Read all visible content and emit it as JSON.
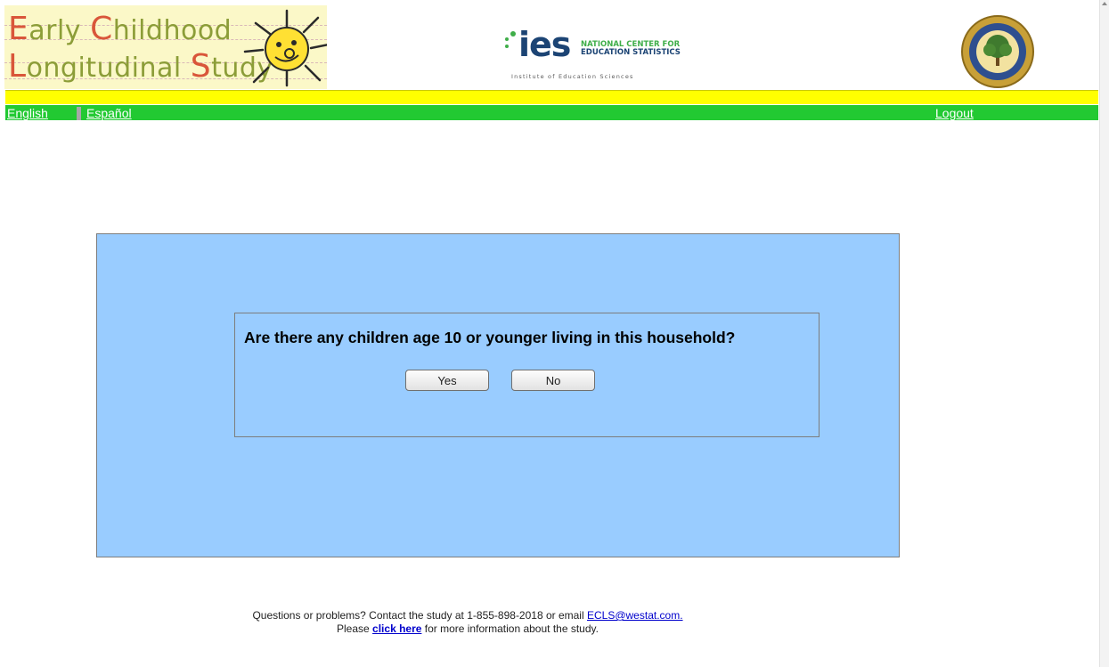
{
  "header": {
    "ecls_logo": {
      "line1_cap1": "E",
      "line1_rest1": "arly ",
      "line1_cap2": "C",
      "line1_rest2": "hildhood",
      "line2_cap1": "L",
      "line2_rest1": "ongitudinal ",
      "line2_cap2": "S",
      "line2_rest2": "tudy"
    },
    "ies_logo": {
      "wordmark": "ies",
      "nces_line1": "NATIONAL CENTER FOR",
      "nces_line2": "EDUCATION STATISTICS",
      "subtitle": "Institute of Education Sciences"
    },
    "seal_icon": "department-of-education-seal"
  },
  "nav": {
    "english": "English",
    "espanol": "Español",
    "logout": "Logout",
    "yellow_bar_color": "#ffff00",
    "green_bar_color": "#22c932"
  },
  "panel": {
    "background": "#99ccff",
    "question": "Are there any children age 10 or younger living in this household?",
    "yes_label": "Yes",
    "no_label": "No"
  },
  "footer": {
    "line1_text": "Questions or problems? Contact the study at 1-855-898-2018 or email ",
    "email_link": "ECLS@westat.com.",
    "line2_prefix": "Please ",
    "click_here": "click here",
    "line2_suffix": " for more information about the study."
  }
}
